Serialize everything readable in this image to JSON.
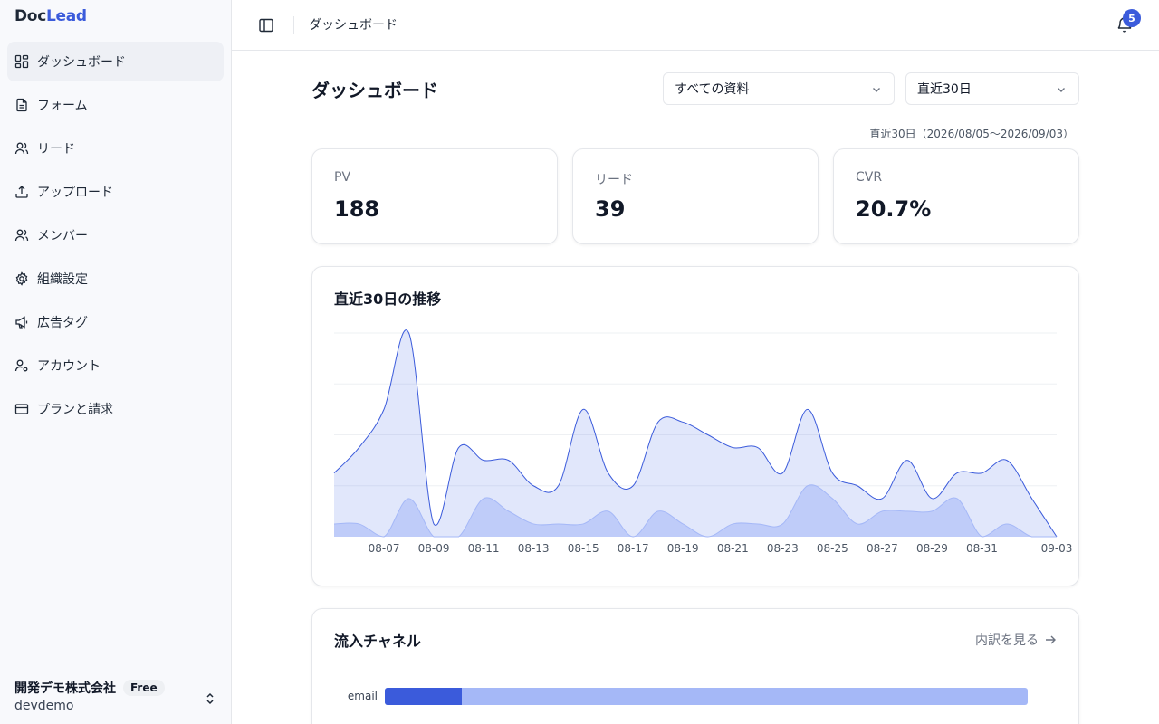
{
  "app": {
    "logo_part1": "Doc",
    "logo_part2": "Lead",
    "brand_color": "#3b5bdb"
  },
  "sidebar": {
    "items": [
      {
        "label": "ダッシュボード",
        "icon": "grid-icon",
        "active": true
      },
      {
        "label": "フォーム",
        "icon": "file-icon"
      },
      {
        "label": "リード",
        "icon": "users-icon"
      },
      {
        "label": "アップロード",
        "icon": "upload-icon"
      },
      {
        "label": "メンバー",
        "icon": "users-icon"
      },
      {
        "label": "組織設定",
        "icon": "gear-icon"
      },
      {
        "label": "広告タグ",
        "icon": "megaphone-icon"
      },
      {
        "label": "アカウント",
        "icon": "user-cog-icon"
      },
      {
        "label": "プランと請求",
        "icon": "credit-card-icon"
      }
    ],
    "org": {
      "name": "開発デモ株式会社",
      "plan": "Free",
      "slug": "devdemo"
    }
  },
  "topbar": {
    "breadcrumb": "ダッシュボード",
    "notification_count": "5"
  },
  "page": {
    "title": "ダッシュボード",
    "filter_document": "すべての資料",
    "filter_range": "直近30日",
    "range_note": "直近30日（2026/08/05〜2026/09/03）"
  },
  "kpis": [
    {
      "label": "PV",
      "value": "188"
    },
    {
      "label": "リード",
      "value": "39"
    },
    {
      "label": "CVR",
      "value": "20.7%"
    }
  ],
  "trend": {
    "title": "直近30日の推移",
    "chart_data": {
      "type": "area",
      "x": [
        "08-05",
        "08-06",
        "08-07",
        "08-08",
        "08-09",
        "08-10",
        "08-11",
        "08-12",
        "08-13",
        "08-14",
        "08-15",
        "08-16",
        "08-17",
        "08-18",
        "08-19",
        "08-20",
        "08-21",
        "08-22",
        "08-23",
        "08-24",
        "08-25",
        "08-26",
        "08-27",
        "08-28",
        "08-29",
        "08-30",
        "08-31",
        "09-01",
        "09-02",
        "09-03"
      ],
      "xtick_labels": [
        "08-07",
        "08-09",
        "08-11",
        "08-13",
        "08-15",
        "08-17",
        "08-19",
        "08-21",
        "08-23",
        "08-25",
        "08-27",
        "08-29",
        "08-31",
        "09-03"
      ],
      "series": [
        {
          "values": [
            5,
            7,
            10,
            16,
            1,
            7,
            6,
            6,
            4,
            4,
            10,
            5,
            4,
            9,
            9,
            8,
            7,
            7,
            5,
            10,
            5,
            4,
            3,
            6,
            3,
            5,
            5,
            6,
            3,
            0
          ],
          "color": "#3b5bdb"
        },
        {
          "values": [
            1,
            1,
            0,
            3,
            0,
            0,
            3,
            2,
            1,
            1,
            1,
            2,
            0,
            2,
            1,
            0,
            1,
            1,
            1,
            4,
            3,
            1,
            2,
            2,
            2,
            3,
            0,
            1,
            0,
            0
          ],
          "color": "#a5b8f7"
        }
      ],
      "ylim": [
        0,
        16
      ],
      "grid": true
    }
  },
  "channels": {
    "title": "流入チャネル",
    "breakdown_link": "内訳を見る",
    "chart_data": {
      "type": "bar",
      "categories": [
        "email"
      ],
      "series": [
        {
          "values": [
            12
          ]
        },
        {
          "values": [
            100
          ]
        }
      ]
    }
  }
}
